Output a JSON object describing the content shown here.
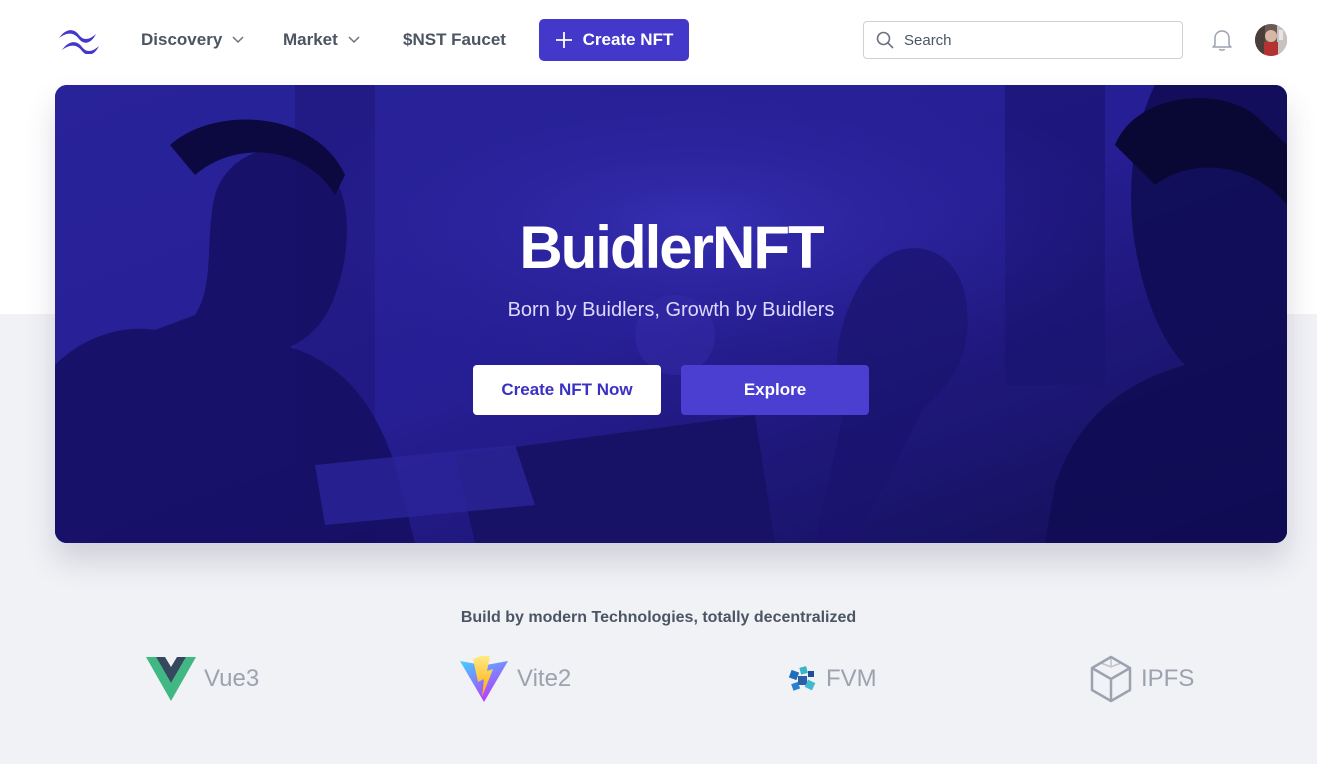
{
  "header": {
    "logo_icon": "tailwind-wave-logo",
    "nav": [
      {
        "label": "Discovery",
        "has_dropdown": true
      },
      {
        "label": "Market",
        "has_dropdown": true
      },
      {
        "label": "$NST Faucet",
        "has_dropdown": false
      }
    ],
    "create_button": {
      "label": "Create NFT",
      "icon": "plus-icon"
    },
    "search": {
      "placeholder": "Search",
      "value": ""
    },
    "notification_icon": "bell-icon",
    "avatar": "user-avatar"
  },
  "hero": {
    "title": "BuidlerNFT",
    "subtitle": "Born by Buidlers, Growth by Buidlers",
    "primary_button": "Create NFT Now",
    "secondary_button": "Explore"
  },
  "tech": {
    "title": "Build by modern Technologies, totally decentralized",
    "items": [
      {
        "label": "Vue3",
        "icon": "vue-logo-icon"
      },
      {
        "label": "Vite2",
        "icon": "vite-logo-icon"
      },
      {
        "label": "FVM",
        "icon": "fvm-logo-icon"
      },
      {
        "label": "IPFS",
        "icon": "ipfs-cube-icon"
      }
    ]
  },
  "colors": {
    "brand": "#4338ca",
    "hero_overlay": "#2a22a0",
    "page_bg": "#f1f2f6"
  }
}
